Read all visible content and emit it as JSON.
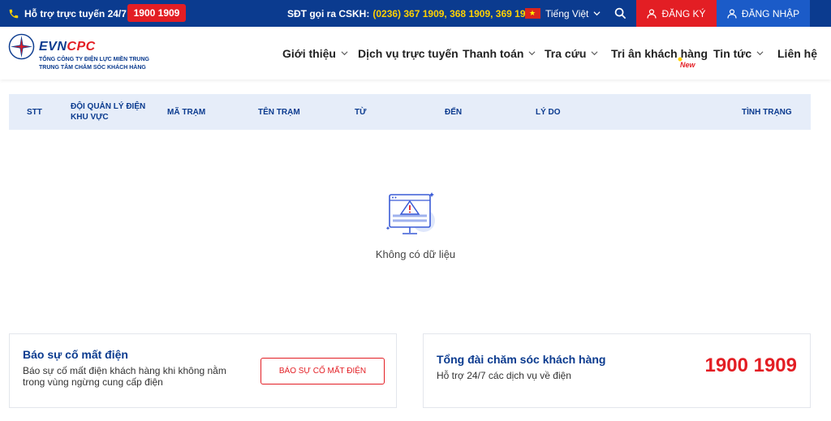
{
  "topbar": {
    "hotline_label": "Hỗ trợ trực tuyến 24/7:",
    "hotline_number": "1900 1909",
    "cskh_label": "SĐT gọi ra CSKH:",
    "cskh_numbers": "(0236) 367 1909, 368 1909, 369 1909",
    "language": "Tiếng Việt",
    "register": "ĐĂNG KÝ",
    "login": "ĐĂNG NHẬP"
  },
  "logo": {
    "evn": "EVN",
    "cpc": "CPC",
    "line1": "TỔNG CÔNG TY ĐIỆN LỰC MIỀN TRUNG",
    "line2": "TRUNG TÂM CHĂM SÓC KHÁCH HÀNG"
  },
  "nav": {
    "items": [
      {
        "label": "Giới thiệu",
        "dropdown": true
      },
      {
        "label": "Dịch vụ trực tuyến",
        "dropdown": false
      },
      {
        "label": "Thanh toán",
        "dropdown": true
      },
      {
        "label": "Tra cứu",
        "dropdown": true
      },
      {
        "label": "Tri ân khách hàng",
        "dropdown": false
      },
      {
        "label": "Tin tức",
        "dropdown": true
      },
      {
        "label": "Liên hệ",
        "dropdown": false
      }
    ],
    "new_badge": "New"
  },
  "table": {
    "columns": [
      "STT",
      "ĐỘI QUẢN LÝ ĐIỆN KHU VỰC",
      "MÃ TRẠM",
      "TÊN TRẠM",
      "TỪ",
      "ĐẾN",
      "LÝ DO",
      "TÌNH TRẠNG"
    ],
    "empty_text": "Không có dữ liệu"
  },
  "cards": {
    "report": {
      "title": "Báo sự cố mất điện",
      "desc": "Báo sự cố mất điện khách hàng khi không nằm trong vùng ngừng cung cấp điện",
      "button": "BÁO SỰ CỐ MẤT ĐIỆN"
    },
    "hotline": {
      "title": "Tổng đài chăm sóc khách hàng",
      "desc": "Hỗ trợ 24/7 các dịch vụ về điện",
      "number": "1900 1909"
    }
  },
  "colors": {
    "primary": "#0b3b8f",
    "accent": "#e31e24",
    "login_bg": "#1b5bc8",
    "highlight": "#ffd200"
  },
  "icons": {
    "phone": "phone-icon",
    "flag": "vietnam-flag-icon",
    "search": "search-icon",
    "user": "user-icon",
    "chevron": "chevron-down-icon",
    "empty": "monitor-warning-icon"
  }
}
